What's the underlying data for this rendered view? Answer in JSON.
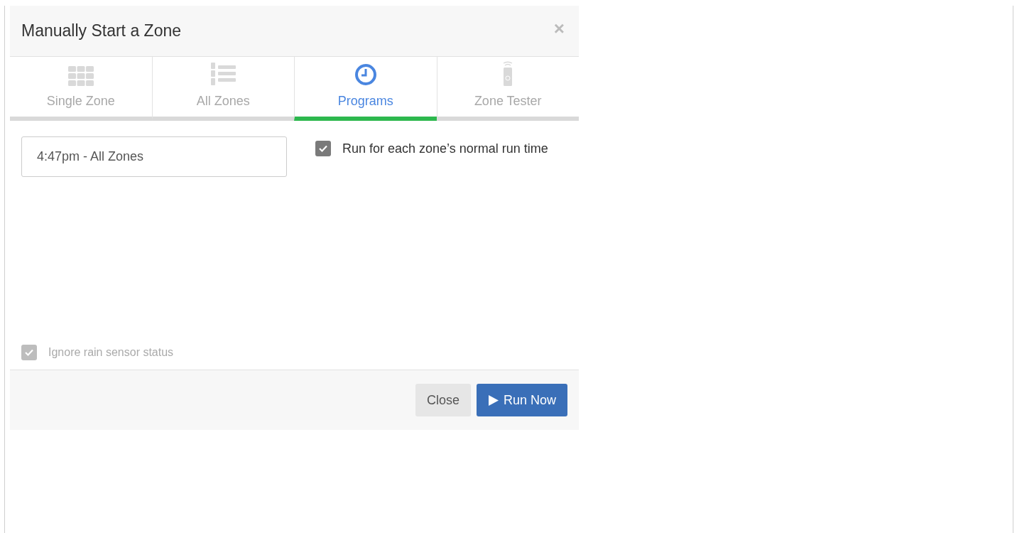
{
  "dialog": {
    "title": "Manually Start a Zone",
    "close": "×"
  },
  "tabs": [
    {
      "label": "Single Zone",
      "selected": false
    },
    {
      "label": "All Zones",
      "selected": false
    },
    {
      "label": "Programs",
      "selected": true
    },
    {
      "label": "Zone Tester",
      "selected": false
    }
  ],
  "program_select": {
    "value": "4:47pm - All Zones"
  },
  "normal_run_time": {
    "label": "Run for each zone’s normal run time",
    "checked": true
  },
  "ignore_rain": {
    "label": "Ignore rain sensor status",
    "checked": true,
    "disabled": true
  },
  "buttons": {
    "close": "Close",
    "run": "Run Now"
  }
}
